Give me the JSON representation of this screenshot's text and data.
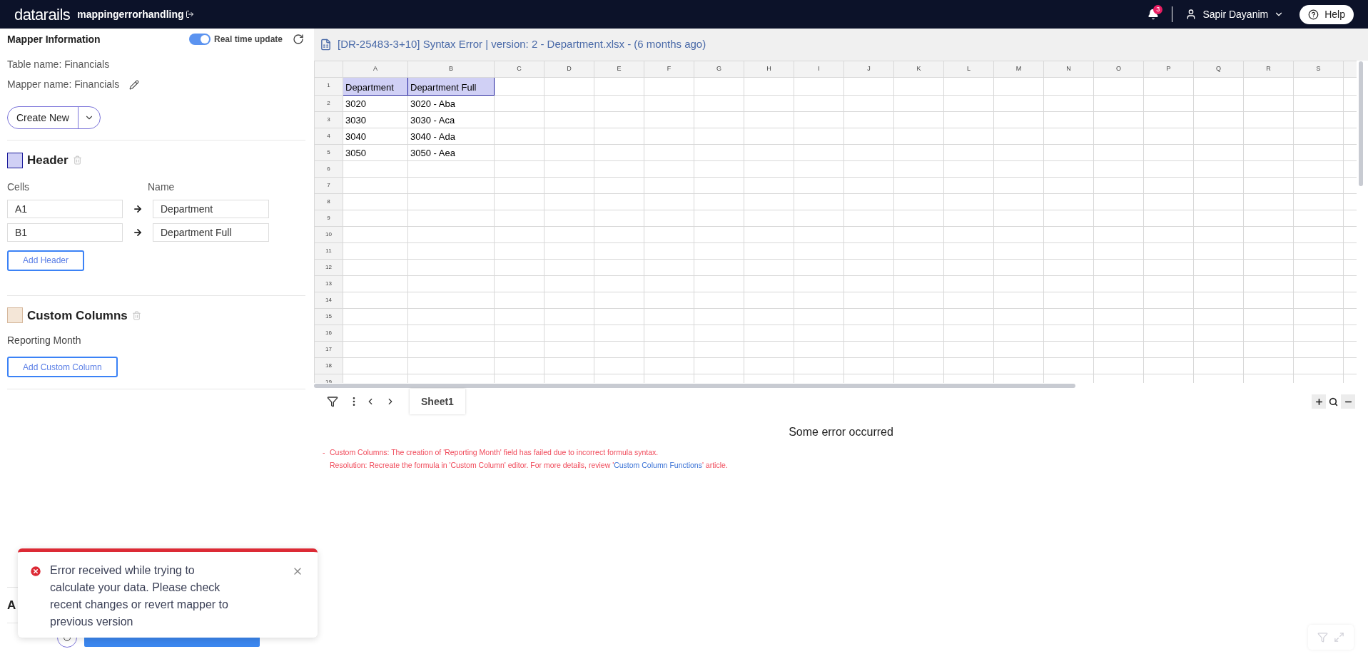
{
  "topbar": {
    "logo": "datarails",
    "workspace": "mappingerrorhandling",
    "notifications": "3",
    "user": "Sapir Dayanim",
    "help": "Help"
  },
  "mapper": {
    "title": "Mapper Information",
    "real_time_update": {
      "label": "Real time update",
      "on": true
    },
    "table_name": "Table name: Financials",
    "mapper_name": "Mapper name: Financials",
    "create_new": "Create New"
  },
  "sections": [
    {
      "kind": "header",
      "title": "Header",
      "color": "#d0d0f5",
      "cells_label": "Cells",
      "name_label": "Name",
      "mappings": [
        {
          "cell": "A1",
          "name": "Department"
        },
        {
          "cell": "B1",
          "name": "Department Full"
        }
      ],
      "button": "Add Header"
    },
    {
      "kind": "custom",
      "title": "Custom Columns",
      "color": "#f4e6d7",
      "items": [
        "Reporting Month"
      ],
      "button": "Add Custom Column"
    }
  ],
  "panel_bottom": {
    "heading": "A"
  },
  "file_title": "[DR-25483-3+10] Syntax Error | version: 2 - Department.xlsx - (6 months ago)",
  "grid": {
    "columns": [
      "A",
      "B",
      "C",
      "D",
      "E",
      "F",
      "G",
      "H",
      "I",
      "J",
      "K",
      "L",
      "M",
      "N",
      "O",
      "P",
      "Q",
      "R",
      "S"
    ],
    "rows": [
      {
        "number": "1",
        "cells": [
          "Department",
          "Department Full"
        ],
        "highlighted": true
      },
      {
        "number": "2",
        "cells": [
          "3020",
          "3020 - Aba"
        ],
        "highlighted": false
      },
      {
        "number": "3",
        "cells": [
          "3030",
          "3030 - Aca"
        ],
        "highlighted": false
      },
      {
        "number": "4",
        "cells": [
          "3040",
          "3040 - Ada"
        ],
        "highlighted": false
      },
      {
        "number": "5",
        "cells": [
          "3050",
          "3050 - Aea"
        ],
        "highlighted": false
      },
      {
        "number": "6",
        "cells": [],
        "highlighted": false
      },
      {
        "number": "7",
        "cells": [],
        "highlighted": false
      },
      {
        "number": "8",
        "cells": [],
        "highlighted": false
      },
      {
        "number": "9",
        "cells": [],
        "highlighted": false
      },
      {
        "number": "10",
        "cells": [],
        "highlighted": false
      },
      {
        "number": "11",
        "cells": [],
        "highlighted": false
      },
      {
        "number": "12",
        "cells": [],
        "highlighted": false
      },
      {
        "number": "13",
        "cells": [],
        "highlighted": false
      },
      {
        "number": "14",
        "cells": [],
        "highlighted": false
      },
      {
        "number": "15",
        "cells": [],
        "highlighted": false
      },
      {
        "number": "16",
        "cells": [],
        "highlighted": false
      },
      {
        "number": "17",
        "cells": [],
        "highlighted": false
      },
      {
        "number": "18",
        "cells": [],
        "highlighted": false
      },
      {
        "number": "19",
        "cells": [],
        "highlighted": false
      }
    ]
  },
  "sheet_tabs": [
    {
      "label": "Sheet1",
      "selected": true
    }
  ],
  "errors": {
    "title": "Some error occurred",
    "bullet": "-",
    "line1": "Custom Columns: The creation of 'Reporting Month' field has failed due to incorrect formula syntax.",
    "line2_before": "Resolution: Recreate the formula in 'Custom Column' editor. For more details, review '",
    "line2_link": "Custom Column Functions",
    "line2_after": "' article."
  },
  "toast": {
    "message": "Error received while trying to calculate your data. Please check recent changes or revert mapper to previous version"
  }
}
